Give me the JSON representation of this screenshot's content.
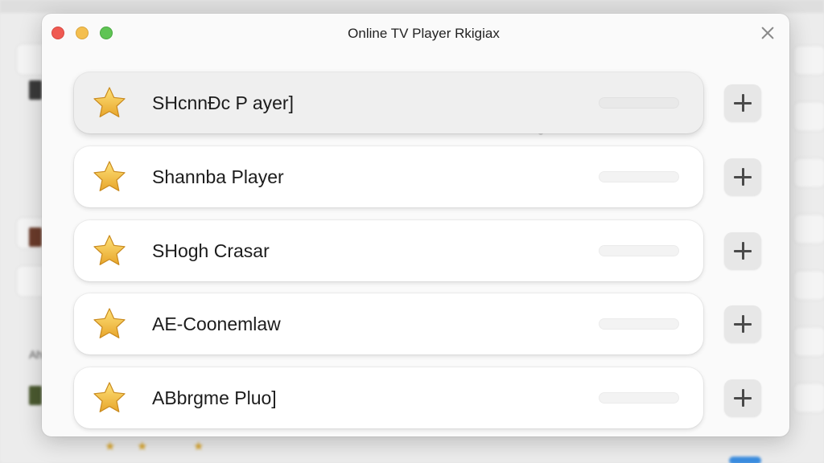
{
  "window": {
    "title": "Online TV Player Rkigiax"
  },
  "players": [
    {
      "label": "SHcnnĐc P ayer]",
      "selected": true,
      "icon": "star-icon"
    },
    {
      "label": "Shannba Player",
      "selected": false,
      "icon": "star-icon"
    },
    {
      "label": "SHogh Crasar",
      "selected": false,
      "icon": "star-icon"
    },
    {
      "label": "AE-Coonemlaw",
      "selected": false,
      "icon": "star-icon"
    },
    {
      "label": "ABbrgme Pluo]",
      "selected": false,
      "icon": "star-icon"
    }
  ],
  "add_button_icon": "plus-icon",
  "close_button_icon": "close-icon",
  "colors": {
    "star": "#F2C14E",
    "traffic_red": "#EF5A52",
    "traffic_yellow": "#F4BF4F",
    "traffic_green": "#5FC454"
  },
  "background": {
    "left_partial_text": "Ah"
  }
}
